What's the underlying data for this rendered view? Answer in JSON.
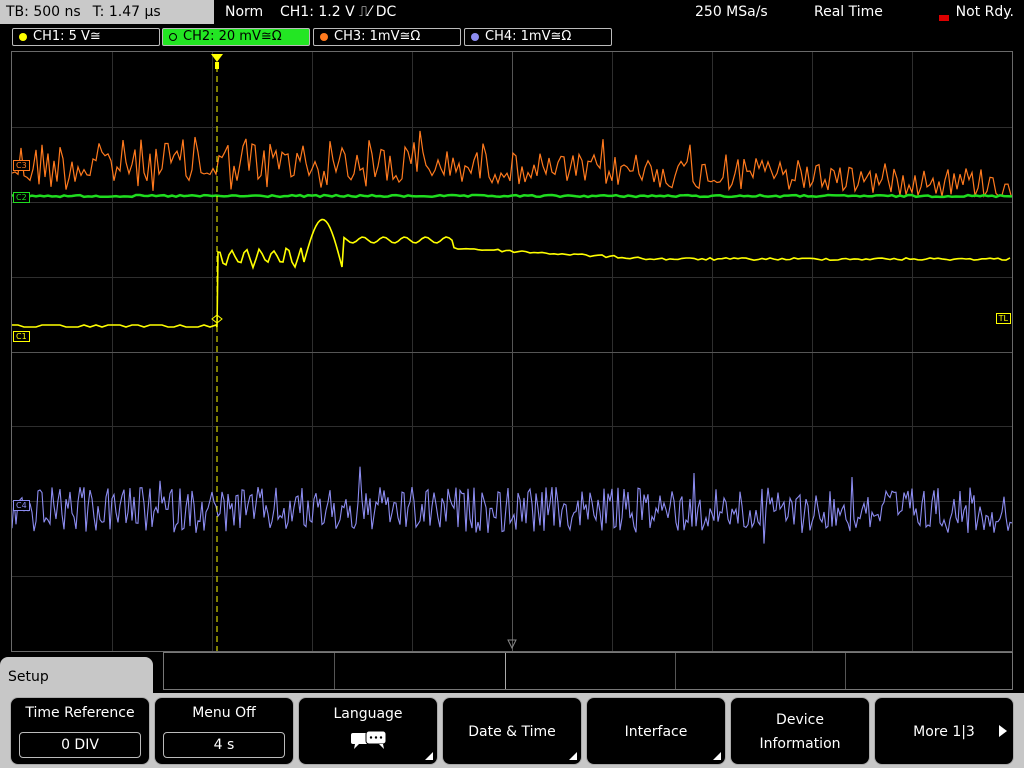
{
  "status": {
    "timebase": "TB: 500 ns",
    "trigger_time": "T: 1.47 µs",
    "trigger_mode": "Norm",
    "trigger_info": "CH1: 1.2 V ⎍⁄ DC",
    "sample_rate": "250 MSa/s",
    "acquisition_mode": "Real Time",
    "trigger_state": "Not Rdy."
  },
  "channels": [
    {
      "label": "CH1: 5 V≅",
      "color": "#ffff00"
    },
    {
      "label": "CH2: 20 mV≅Ω",
      "color": "#1fdc1f"
    },
    {
      "label": "CH3: 1mV≅Ω",
      "color": "#ff7a1e"
    },
    {
      "label": "CH4: 1mV≅Ω",
      "color": "#8c8cf0"
    }
  ],
  "markers": {
    "c1": "C1",
    "c2": "C2",
    "c3": "C3",
    "c4": "C4",
    "trigger_level": "TL"
  },
  "menu": {
    "title": "Setup",
    "softkeys": {
      "time_reference": {
        "label": "Time Reference",
        "value": "0 DIV"
      },
      "menu_off": {
        "label": "Menu Off",
        "value": "4 s"
      },
      "language": {
        "label": "Language",
        "icon": "speech-bubbles-icon"
      },
      "date_time": {
        "label": "Date & Time"
      },
      "interface": {
        "label": "Interface"
      },
      "device_info": {
        "line1": "Device",
        "line2": "Information"
      },
      "more": {
        "label": "More 1|3"
      }
    }
  }
}
